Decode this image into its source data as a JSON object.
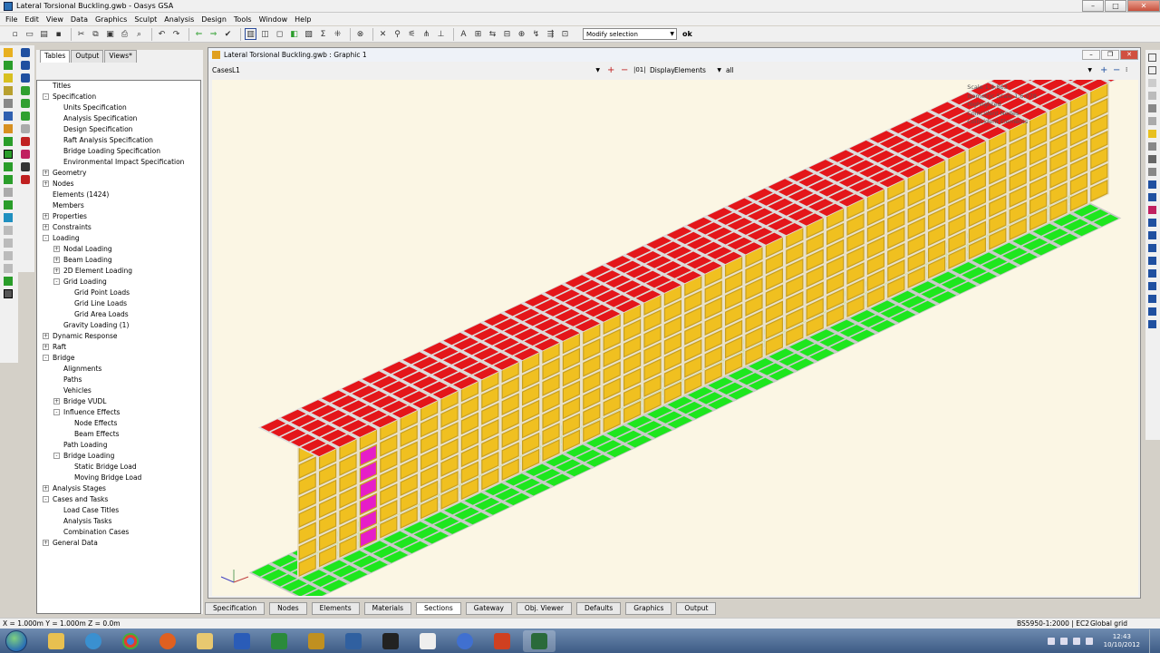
{
  "app": {
    "title": "Lateral Torsional Buckling.gwb - Oasys GSA"
  },
  "menu": [
    "File",
    "Edit",
    "View",
    "Data",
    "Graphics",
    "Sculpt",
    "Analysis",
    "Design",
    "Tools",
    "Window",
    "Help"
  ],
  "toolbar": {
    "selection_mode": "Modify selection",
    "ok_label": "ok"
  },
  "tree": {
    "tabs": [
      "Tables",
      "Output",
      "Views*"
    ],
    "items": [
      {
        "label": "Titles",
        "level": 0,
        "expander": ""
      },
      {
        "label": "Specification",
        "level": 0,
        "expander": "-"
      },
      {
        "label": "Units Specification",
        "level": 1,
        "expander": ""
      },
      {
        "label": "Analysis Specification",
        "level": 1,
        "expander": ""
      },
      {
        "label": "Design Specification",
        "level": 1,
        "expander": ""
      },
      {
        "label": "Raft Analysis Specification",
        "level": 1,
        "expander": ""
      },
      {
        "label": "Bridge Loading Specification",
        "level": 1,
        "expander": ""
      },
      {
        "label": "Environmental Impact Specification",
        "level": 1,
        "expander": ""
      },
      {
        "label": "Geometry",
        "level": 0,
        "expander": "+"
      },
      {
        "label": "Nodes",
        "level": 0,
        "expander": "+"
      },
      {
        "label": "Elements (1424)",
        "level": 0,
        "expander": ""
      },
      {
        "label": "Members",
        "level": 0,
        "expander": ""
      },
      {
        "label": "Properties",
        "level": 0,
        "expander": "+"
      },
      {
        "label": "Constraints",
        "level": 0,
        "expander": "+"
      },
      {
        "label": "Loading",
        "level": 0,
        "expander": "-"
      },
      {
        "label": "Nodal Loading",
        "level": 1,
        "expander": "+"
      },
      {
        "label": "Beam Loading",
        "level": 1,
        "expander": "+"
      },
      {
        "label": "2D Element Loading",
        "level": 1,
        "expander": "+"
      },
      {
        "label": "Grid Loading",
        "level": 1,
        "expander": "-"
      },
      {
        "label": "Grid Point Loads",
        "level": 2,
        "expander": ""
      },
      {
        "label": "Grid Line Loads",
        "level": 2,
        "expander": ""
      },
      {
        "label": "Grid Area Loads",
        "level": 2,
        "expander": ""
      },
      {
        "label": "Gravity Loading (1)",
        "level": 1,
        "expander": ""
      },
      {
        "label": "Dynamic Response",
        "level": 0,
        "expander": "+"
      },
      {
        "label": "Raft",
        "level": 0,
        "expander": "+"
      },
      {
        "label": "Bridge",
        "level": 0,
        "expander": "-"
      },
      {
        "label": "Alignments",
        "level": 1,
        "expander": ""
      },
      {
        "label": "Paths",
        "level": 1,
        "expander": ""
      },
      {
        "label": "Vehicles",
        "level": 1,
        "expander": ""
      },
      {
        "label": "Bridge VUDL",
        "level": 1,
        "expander": "+"
      },
      {
        "label": "Influence Effects",
        "level": 1,
        "expander": "-"
      },
      {
        "label": "Node Effects",
        "level": 2,
        "expander": ""
      },
      {
        "label": "Beam Effects",
        "level": 2,
        "expander": ""
      },
      {
        "label": "Path Loading",
        "level": 1,
        "expander": ""
      },
      {
        "label": "Bridge Loading",
        "level": 1,
        "expander": "-"
      },
      {
        "label": "Static Bridge Load",
        "level": 2,
        "expander": ""
      },
      {
        "label": "Moving Bridge Load",
        "level": 2,
        "expander": ""
      },
      {
        "label": "Analysis Stages",
        "level": 0,
        "expander": "+"
      },
      {
        "label": "Cases and Tasks",
        "level": 0,
        "expander": "-"
      },
      {
        "label": "Load Case Titles",
        "level": 1,
        "expander": ""
      },
      {
        "label": "Analysis Tasks",
        "level": 1,
        "expander": ""
      },
      {
        "label": "Combination Cases",
        "level": 1,
        "expander": ""
      },
      {
        "label": "General Data",
        "level": 0,
        "expander": "+"
      }
    ]
  },
  "graphic": {
    "title": "Lateral Torsional Buckling.gwb : Graphic 1",
    "cases_label": "Cases",
    "cases_value": "L1",
    "display_label": "Display",
    "display_value": "Elements",
    "filter_value": "all",
    "scale_lines": [
      "Scale 1:4.863",
      "Isometric Scale 1:6.078",
      "Highlighted",
      "Coincident Nodes",
      "Coincident Elements"
    ]
  },
  "bottom_tabs": [
    "Specification",
    "Nodes",
    "Elements",
    "Materials",
    "Sections",
    "Gateway",
    "Obj. Viewer",
    "Defaults",
    "Graphics",
    "Output"
  ],
  "bottom_tabs_active": "Sections",
  "status": {
    "coords": "X = 1.000m   Y = 1.000m   Z = 0.0m",
    "design_code": "BS5950-1:2000 | EC2",
    "grid": "Global grid"
  },
  "taskbar": {
    "time": "12:43",
    "date": "10/10/2012"
  },
  "colors": {
    "top_flange": "#e4161a",
    "web": "#f0c020",
    "bottom_flange": "#1ee61e",
    "highlight": "#e61ec8",
    "viewport_bg": "#fbf6e4"
  }
}
